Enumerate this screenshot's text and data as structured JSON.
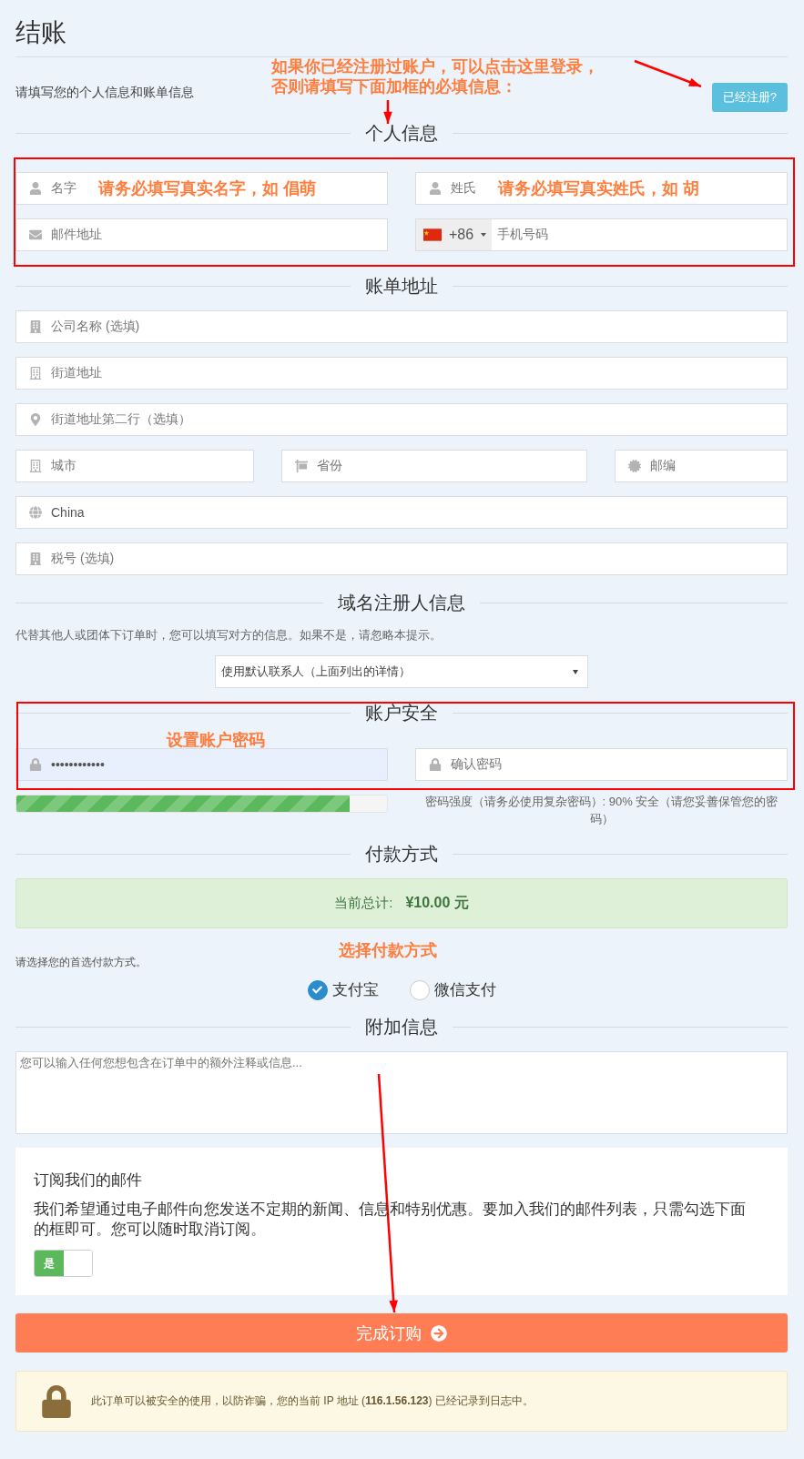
{
  "page_title": "结账",
  "intro": {
    "text": "请填写您的个人信息和账单信息",
    "note_lines": [
      "如果你已经注册过账户，可以点击这里登录，",
      "否则请填写下面加框的必填信息："
    ],
    "login_button": "已经注册?"
  },
  "personal": {
    "heading": "个人信息",
    "fields": [
      {
        "placeholder": "名字",
        "note": "请务必填写真实名字，如 倡萌"
      },
      {
        "placeholder": "姓氏",
        "note": "请务必填写真实姓氏，如 胡"
      },
      {
        "placeholder": "邮件地址"
      }
    ],
    "phone": {
      "code": "+86",
      "placeholder": "手机号码"
    }
  },
  "billing": {
    "heading": "账单地址",
    "rows": [
      [
        {
          "placeholder": "公司名称 (选填)"
        }
      ],
      [
        {
          "placeholder": "街道地址"
        }
      ],
      [
        {
          "placeholder": "街道地址第二行（选填）"
        }
      ],
      [
        {
          "placeholder": "城市"
        },
        {
          "placeholder": "省份"
        },
        {
          "placeholder": "邮编"
        }
      ],
      [
        {
          "value": "China"
        }
      ],
      [
        {
          "placeholder": "税号 (选填)"
        }
      ]
    ]
  },
  "registrant": {
    "heading": "域名注册人信息",
    "text": "代替其他人或团体下订单时，您可以填写对方的信息。如果不是，请忽略本提示。",
    "select_value": "使用默认联系人（上面列出的详情）"
  },
  "security": {
    "heading": "账户安全",
    "note": "设置账户密码",
    "password": {
      "value": "••••••••••••"
    },
    "confirm": {
      "placeholder": "确认密码"
    },
    "strength": {
      "level": 0.9,
      "text": "密码强度（请务必使用复杂密码）: 90% 安全（请您妥善保管您的密码）"
    }
  },
  "payment": {
    "heading": "付款方式",
    "total_label": "当前总计:",
    "total": "¥10.00 元",
    "prompt": "请选择您的首选付款方式。",
    "note": "选择付款方式",
    "methods": [
      {
        "label": "支付宝",
        "selected": true
      },
      {
        "label": "微信支付",
        "selected": false
      }
    ]
  },
  "additional": {
    "heading": "附加信息",
    "placeholder": "您可以输入任何您想包含在订单中的额外注释或信息..."
  },
  "newsletter": {
    "title": "订阅我们的邮件",
    "text": "我们希望通过电子邮件向您发送不定期的新闻、信息和特别优惠。要加入我们的邮件列表，只需勾选下面的框即可。您可以随时取消订阅。",
    "toggle": {
      "label": "是",
      "on": true
    }
  },
  "submit_button": "完成订购",
  "security_notice": "此订单可以被安全的使用，以防诈骗，您的当前 IP 地址 (**116.1.56.123**) 已经记录到日志中。"
}
